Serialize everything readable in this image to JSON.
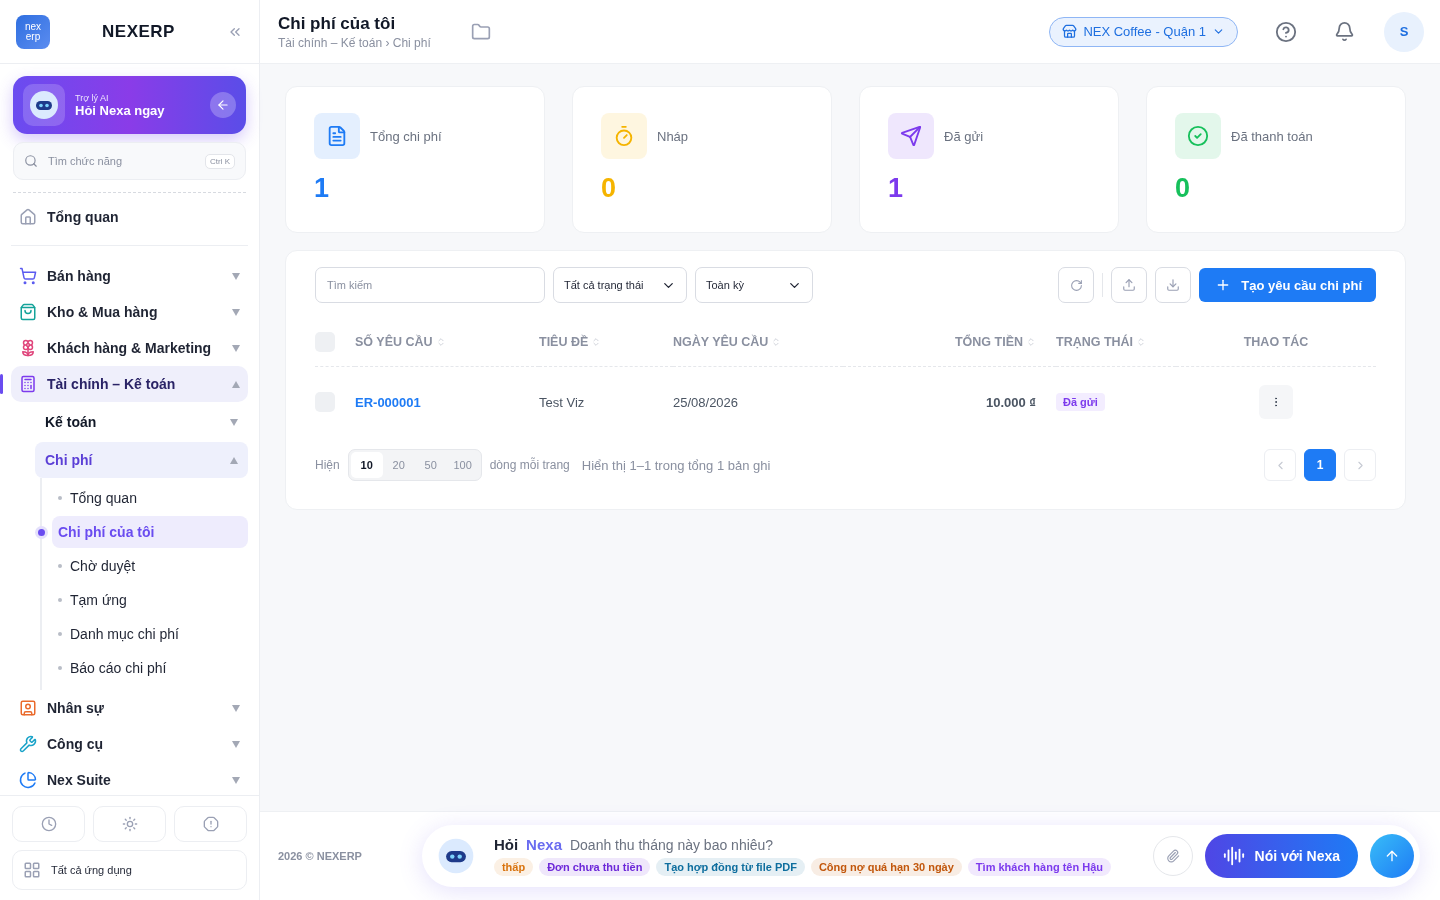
{
  "sidebar": {
    "logo_text": [
      "nex",
      "erp"
    ],
    "brand": "NEXERP",
    "ai_card": {
      "caption": "Trợ lý AI",
      "title": "Hỏi Nexa ngay"
    },
    "search": {
      "placeholder": "Tìm chức năng",
      "shortcut": "Ctrl K"
    },
    "nav": [
      {
        "label": "Tổng quan",
        "selected": false
      },
      {
        "label": "Bán hàng",
        "expanded": false,
        "selected": false
      },
      {
        "label": "Kho & Mua hàng",
        "expanded": false,
        "selected": false
      },
      {
        "label": "Khách hàng & Marketing",
        "expanded": false,
        "selected": false
      },
      {
        "label": "Tài chính – Kế toán",
        "expanded": true,
        "selected": true,
        "children": [
          {
            "label": "Kế toán",
            "expanded": false,
            "selected": false
          },
          {
            "label": "Chi phí",
            "expanded": true,
            "selected": true,
            "children": [
              {
                "label": "Tổng quan",
                "selected": false
              },
              {
                "label": "Chi phí của tôi",
                "selected": true
              },
              {
                "label": "Chờ duyệt",
                "selected": false
              },
              {
                "label": "Tạm ứng",
                "selected": false
              },
              {
                "label": "Danh mục chi phí",
                "selected": false
              },
              {
                "label": "Báo cáo chi phí",
                "selected": false
              }
            ]
          }
        ]
      },
      {
        "label": "Nhân sự",
        "expanded": false,
        "selected": false
      },
      {
        "label": "Công cụ",
        "expanded": false,
        "selected": false
      },
      {
        "label": "Nex Suite",
        "expanded": false,
        "selected": false
      }
    ],
    "all_apps": "Tất cả ứng dụng"
  },
  "header": {
    "title": "Chi phí của tôi",
    "breadcrumb": "Tài chính – Kế toán › Chi phí",
    "store": "NEX Coffee - Quận 1",
    "avatar": "S"
  },
  "stats": [
    {
      "label": "Tổng chi phí",
      "value": "1",
      "color": "#1e7bf5"
    },
    {
      "label": "Nháp",
      "value": "0",
      "color": "#f5b400"
    },
    {
      "label": "Đã gửi",
      "value": "1",
      "color": "#7c3aed"
    },
    {
      "label": "Đã thanh toán",
      "value": "0",
      "color": "#16c05b"
    }
  ],
  "toolbar": {
    "search_placeholder": "Tìm kiếm",
    "filters": [
      "Tất cả trạng thái",
      "Toàn kỳ"
    ],
    "create": "Tạo yêu cầu chi phí"
  },
  "table": {
    "select_all_checked": false,
    "columns": [
      {
        "label": "SỐ YÊU CẦU",
        "sortable": true
      },
      {
        "label": "TIÊU ĐỀ",
        "sortable": true
      },
      {
        "label": "NGÀY YÊU CẦU",
        "sortable": true
      },
      {
        "label": "TỔNG TIỀN",
        "sortable": true
      },
      {
        "label": "TRẠNG THÁI",
        "sortable": true
      },
      {
        "label": "THAO TÁC",
        "sortable": false
      }
    ],
    "rows": [
      {
        "checked": false,
        "id": "ER-000001",
        "title": "Test Viz",
        "date": "25/08/2026",
        "total": "10.000 ₫",
        "status": "Đã gửi"
      }
    ]
  },
  "pagination": {
    "show_label": "Hiện",
    "sizes": [
      {
        "label": "10",
        "selected": true
      },
      {
        "label": "20",
        "selected": false
      },
      {
        "label": "50",
        "selected": false
      },
      {
        "label": "100",
        "selected": false
      }
    ],
    "per_page": "dòng mỗi trang",
    "summary": "Hiển thị 1–1 trong tổng 1 bản ghi",
    "pages": [
      {
        "label": "1",
        "selected": true
      }
    ]
  },
  "footer": {
    "copyright": "2026 © NEXERP",
    "assistant": {
      "ask": "Hỏi",
      "name": "Nexa",
      "prompt": "Doanh thu tháng này bao nhiêu?",
      "chips": [
        {
          "label": "thấp",
          "color": "#d9730d"
        },
        {
          "label": "Đơn chưa thu tiền",
          "color": "#6d28d9"
        },
        {
          "label": "Tạo hợp đồng từ file PDF",
          "color": "#0e6e9e"
        },
        {
          "label": "Công nợ quá hạn 30 ngày",
          "color": "#c2570c"
        },
        {
          "label": "Tìm khách hàng tên Hậu",
          "color": "#7c3aed"
        }
      ],
      "voice": "Nói với Nexa"
    }
  }
}
